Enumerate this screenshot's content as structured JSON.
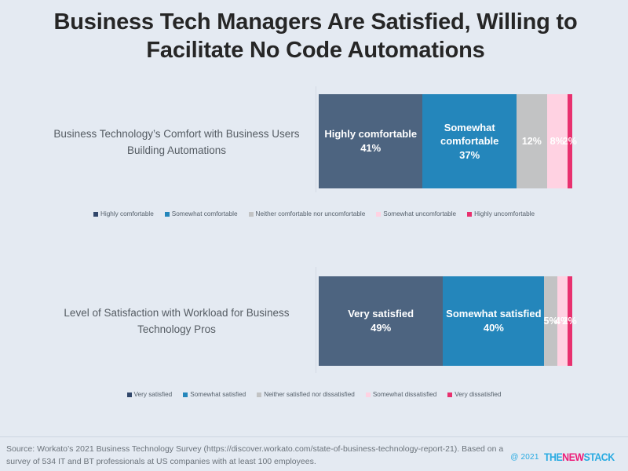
{
  "title": "Business Tech Managers Are Satisfied, Willing to Facilitate No Code Automations",
  "colors": {
    "background": "#e4eaf2",
    "highly": "#4d6480",
    "somewhat": "#2486bb",
    "neutral": "#c2c3c4",
    "somewhat_neg": "#ffd2e2",
    "highly_neg": "#e8316f",
    "title_text": "#262626",
    "label_text": "#555c63",
    "logo_cyan": "#29abe2",
    "logo_pink": "#ed1e79"
  },
  "chart_data": [
    {
      "type": "bar",
      "orientation": "horizontal",
      "stacked": true,
      "percent_stacked": true,
      "id": "comfort",
      "title": "Business Technology's Comfort with Business Users Building Automations",
      "category_label": "Business Technology’s Comfort with Business Users Building Automations",
      "categories": [
        "Business Technology Comfort"
      ],
      "xlabel": "",
      "ylabel": "",
      "xlim": [
        0,
        100
      ],
      "grid": false,
      "legend_position": "bottom",
      "series": [
        {
          "name": "Highly comfortable",
          "label": "Highly comfortable",
          "value": 41,
          "value_label": "41%",
          "color": "#4d6480"
        },
        {
          "name": "Somewhat comfortable",
          "label": "Somewhat comfortable",
          "value": 37,
          "value_label": "37%",
          "color": "#2486bb"
        },
        {
          "name": "Neither comfortable nor uncomfortable",
          "label": "",
          "value": 12,
          "value_label": "12%",
          "color": "#c2c3c4"
        },
        {
          "name": "Somewhat uncomfortable",
          "label": "",
          "value": 8,
          "value_label": "8%",
          "color": "#ffd2e2"
        },
        {
          "name": "Highly uncomfortable",
          "label": "",
          "value": 2,
          "value_label": "2%",
          "color": "#e8316f"
        }
      ]
    },
    {
      "type": "bar",
      "orientation": "horizontal",
      "stacked": true,
      "percent_stacked": true,
      "id": "satisfaction",
      "title": "Level of Satisfaction with Workload for Business Technology Pros",
      "category_label": "Level of Satisfaction with Workload for Business Technology Pros",
      "categories": [
        "Level of Satisfaction"
      ],
      "xlabel": "",
      "ylabel": "",
      "xlim": [
        0,
        100
      ],
      "grid": false,
      "legend_position": "bottom",
      "series": [
        {
          "name": "Very satisfied",
          "label": "Very satisfied",
          "value": 49,
          "value_label": "49%",
          "color": "#4d6480"
        },
        {
          "name": "Somewhat satisfied",
          "label": "Somewhat satisfied",
          "value": 40,
          "value_label": "40%",
          "color": "#2486bb"
        },
        {
          "name": "Neither satisfied nor dissatisfied",
          "label": "",
          "value": 5,
          "value_label": "5%",
          "color": "#c2c3c4"
        },
        {
          "name": "Somewhat dissatisfied",
          "label": "",
          "value": 4,
          "value_label": "4%",
          "color": "#ffd2e2"
        },
        {
          "name": "Very dissatisfied",
          "label": "",
          "value": 2,
          "value_label": "2%",
          "color": "#e8316f"
        }
      ]
    }
  ],
  "chart1": {
    "category_label": "Business Technology’s Comfort with Business Users Building Automations",
    "segments": [
      {
        "label": "Highly comfortable",
        "pct": "41%"
      },
      {
        "label": "Somewhat comfortable",
        "pct": "37%"
      },
      {
        "label": "",
        "pct": "12%"
      },
      {
        "label": "",
        "pct": "8%"
      },
      {
        "label": "",
        "pct": "2%"
      }
    ],
    "legend": [
      "Highly comfortable",
      "Somewhat comfortable",
      "Neither comfortable nor uncomfortable",
      "Somewhat uncomfortable",
      "Highly uncomfortable"
    ]
  },
  "chart2": {
    "category_label": "Level of Satisfaction with Workload for Business Technology Pros",
    "segments": [
      {
        "label": "Very satisfied",
        "pct": "49%"
      },
      {
        "label": "Somewhat satisfied",
        "pct": "40%"
      },
      {
        "label": "",
        "pct": "5%"
      },
      {
        "label": "",
        "pct": "4%"
      },
      {
        "label": "",
        "pct": "2%"
      }
    ],
    "legend": [
      "Very satisfied",
      "Somewhat satisfied",
      "Neither satisfied nor dissatisfied",
      "Somewhat dissatisfied",
      "Very dissatisfied"
    ]
  },
  "footer": {
    "source": "Source: Workato’s 2021 Business Technology Survey (https://discover.workato.com/state-of-business-technology-report-21). Based on a survey of 534 IT and BT professionals at US companies with at least 100 employees.",
    "copyright": "@ 2021",
    "logo_the": "THE",
    "logo_new": "NEW",
    "logo_stack": "STACK"
  }
}
